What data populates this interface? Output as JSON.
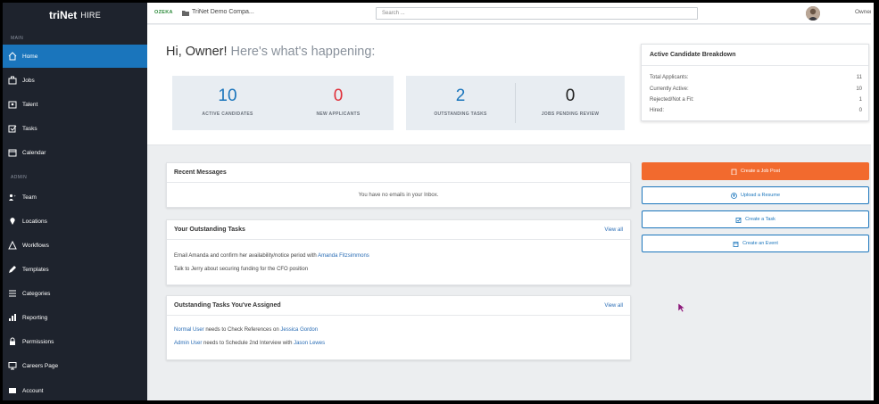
{
  "app": {
    "logo": "triNet",
    "logo_suffix": "HIRE",
    "brand_color": "#1a75bc",
    "accent_color": "#f26a2e"
  },
  "sidebar": {
    "section_main": "MAIN",
    "section_admin": "ADMIN",
    "items": [
      {
        "label": "Home",
        "icon": "home-icon"
      },
      {
        "label": "Jobs",
        "icon": "briefcase-icon"
      },
      {
        "label": "Talent",
        "icon": "id-card-icon"
      },
      {
        "label": "Tasks",
        "icon": "tasks-icon"
      },
      {
        "label": "Calendar",
        "icon": "calendar-icon"
      },
      {
        "label": "Team",
        "icon": "team-icon"
      },
      {
        "label": "Locations",
        "icon": "map-pin-icon"
      },
      {
        "label": "Workflows",
        "icon": "workflow-icon"
      },
      {
        "label": "Templates",
        "icon": "pencil-icon"
      },
      {
        "label": "Categories",
        "icon": "list-icon"
      },
      {
        "label": "Reporting",
        "icon": "bar-chart-icon"
      },
      {
        "label": "Permissions",
        "icon": "lock-icon"
      },
      {
        "label": "Careers Page",
        "icon": "monitor-icon"
      },
      {
        "label": "Account",
        "icon": "account-icon"
      }
    ]
  },
  "topbar": {
    "brand_badge": "OZEKA",
    "company": "TriNet Demo Compa...",
    "search_placeholder": "Search ...",
    "user_name": "Owner"
  },
  "hero": {
    "greeting": "Hi, Owner!",
    "greeting_sub": "Here's what's happening:",
    "stats": [
      {
        "value": "10",
        "label": "ACTIVE CANDIDATES",
        "color": "#1a75bc"
      },
      {
        "value": "0",
        "label": "NEW APPLICANTS",
        "color": "#e0303a"
      },
      {
        "value": "2",
        "label": "OUTSTANDING TASKS",
        "color": "#1a75bc"
      },
      {
        "value": "0",
        "label": "JOBS PENDING REVIEW",
        "color": "#222222"
      }
    ]
  },
  "breakdown": {
    "title": "Active Candidate Breakdown",
    "rows": [
      {
        "label": "Total Applicants:",
        "value": "11"
      },
      {
        "label": "Currently Active:",
        "value": "10"
      },
      {
        "label": "Rejected/Not a Fit:",
        "value": "1"
      },
      {
        "label": "Hired:",
        "value": "0"
      }
    ]
  },
  "messages": {
    "title": "Recent Messages",
    "empty": "You have no emails in your Inbox."
  },
  "tasks": {
    "title": "Your Outstanding Tasks",
    "view_all": "View all",
    "items": [
      {
        "text": "Email Amanda and confirm her availability/notice period with ",
        "link": "Amanda Fitzsimmons"
      },
      {
        "text": "Talk to Jerry about securing funding for the CFO position",
        "link": ""
      }
    ]
  },
  "assigned": {
    "title": "Outstanding Tasks You've Assigned",
    "view_all": "View all",
    "items": [
      {
        "user": "Normal User",
        "text": " needs to Check References on ",
        "link": "Jessica Gordon"
      },
      {
        "user": "Admin User",
        "text": " needs to Schedule 2nd Interview with ",
        "link": "Jason Lewes"
      }
    ]
  },
  "actions": [
    {
      "label": "Create a Job Post",
      "icon": "building-icon"
    },
    {
      "label": "Upload a Resume",
      "icon": "upload-icon"
    },
    {
      "label": "Create a Task",
      "icon": "task-icon"
    },
    {
      "label": "Create an Event",
      "icon": "calendar-plus-icon"
    }
  ]
}
